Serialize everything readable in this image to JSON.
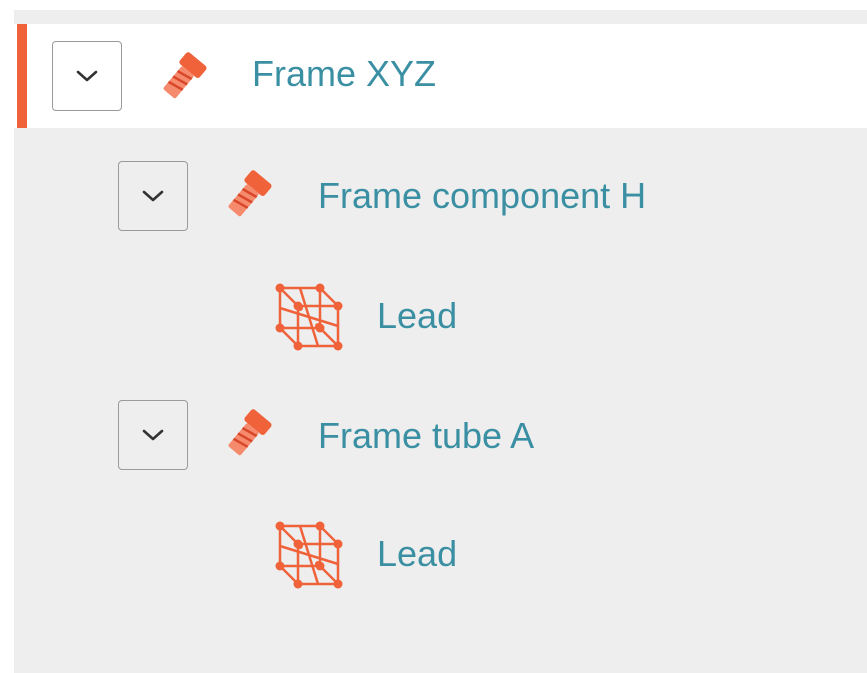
{
  "colors": {
    "accent": "#f0623a",
    "label": "#3a8fa3",
    "panel_background": "#eeeeee",
    "selected_background": "#ffffff"
  },
  "tree": {
    "nodes": [
      {
        "label": "Frame XYZ",
        "icon": "bolt-icon",
        "expandable": true,
        "selected": true,
        "level": 0
      },
      {
        "label": "Frame component H",
        "icon": "bolt-icon",
        "expandable": true,
        "selected": false,
        "level": 1
      },
      {
        "label": "Lead",
        "icon": "wireframe-cube-icon",
        "expandable": false,
        "selected": false,
        "level": 2
      },
      {
        "label": "Frame tube A",
        "icon": "bolt-icon",
        "expandable": true,
        "selected": false,
        "level": 1
      },
      {
        "label": "Lead",
        "icon": "wireframe-cube-icon",
        "expandable": false,
        "selected": false,
        "level": 2
      }
    ]
  }
}
